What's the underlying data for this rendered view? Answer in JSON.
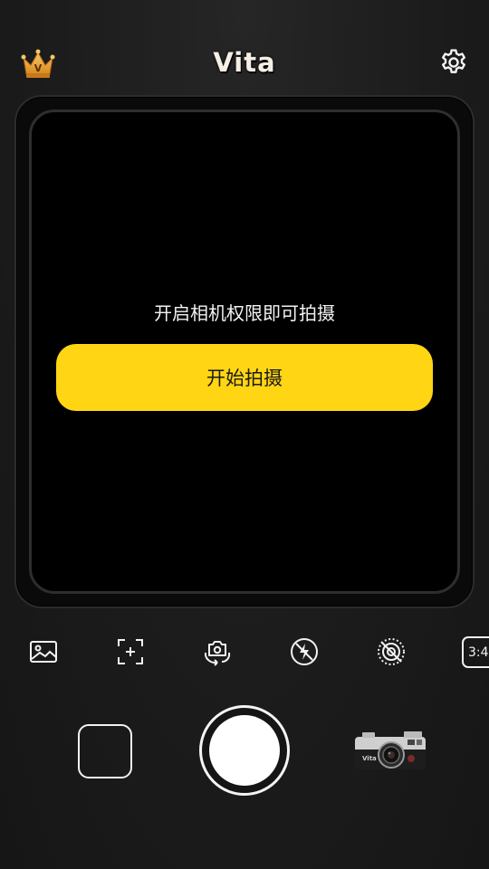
{
  "header": {
    "app_title": "Vita",
    "crown_letter": "V",
    "crown_icon": "crown-icon",
    "settings_icon": "gear-icon"
  },
  "viewfinder": {
    "permission_message": "开启相机权限即可拍摄",
    "start_button_label": "开始拍摄",
    "accent_color": "#FFD514"
  },
  "toolbar": {
    "items": [
      {
        "icon": "gallery-icon"
      },
      {
        "icon": "focus-frame-icon"
      },
      {
        "icon": "flip-camera-icon"
      },
      {
        "icon": "flash-off-icon"
      },
      {
        "icon": "live-off-icon"
      }
    ],
    "aspect_ratio_label": "3:4"
  },
  "bottom": {
    "camera_model_label": "Vita"
  }
}
